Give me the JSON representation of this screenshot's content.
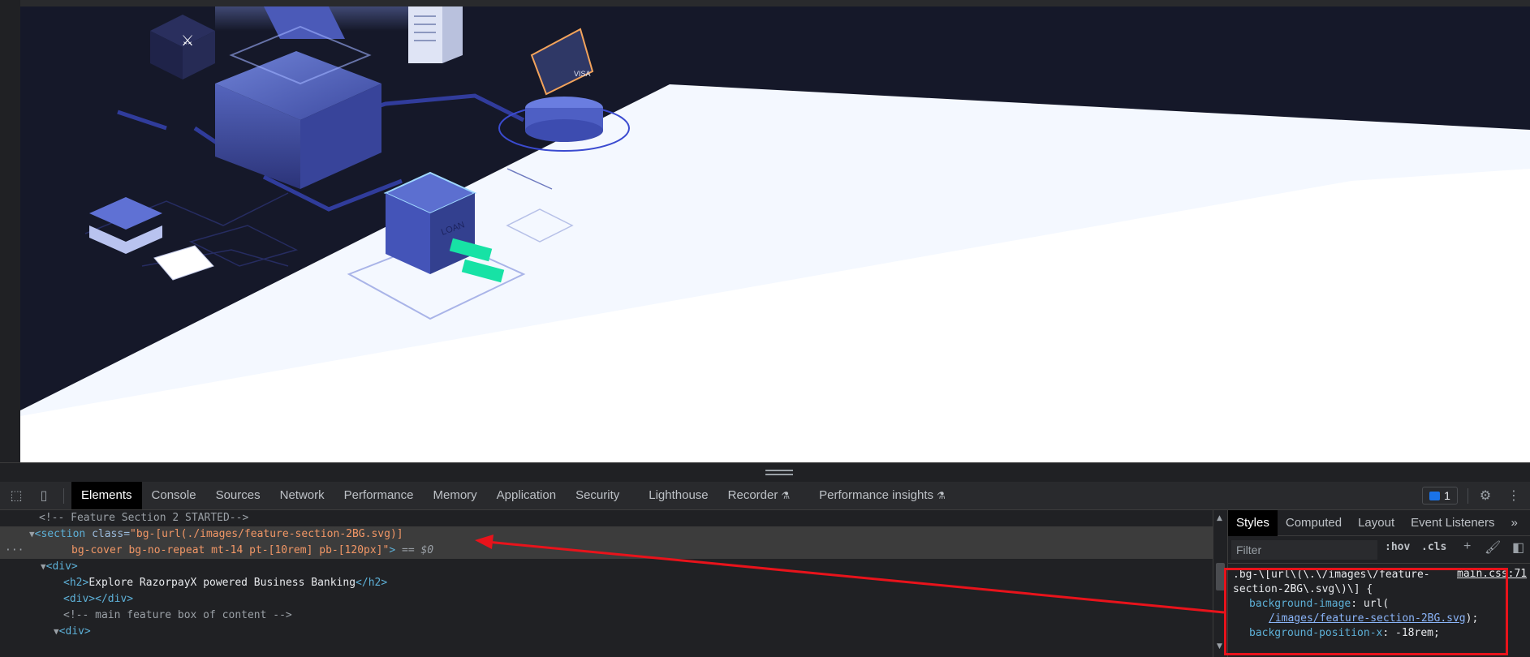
{
  "devtools": {
    "tabs": [
      {
        "label": "Elements",
        "active": true,
        "experimental": false
      },
      {
        "label": "Console",
        "active": false,
        "experimental": false
      },
      {
        "label": "Sources",
        "active": false,
        "experimental": false
      },
      {
        "label": "Network",
        "active": false,
        "experimental": false
      },
      {
        "label": "Performance",
        "active": false,
        "experimental": false
      },
      {
        "label": "Memory",
        "active": false,
        "experimental": false
      },
      {
        "label": "Application",
        "active": false,
        "experimental": false
      },
      {
        "label": "Security",
        "active": false,
        "experimental": false
      },
      {
        "label": "Lighthouse",
        "active": false,
        "experimental": false
      },
      {
        "label": "Recorder",
        "active": false,
        "experimental": true
      },
      {
        "label": "Performance insights",
        "active": false,
        "experimental": true
      }
    ],
    "issues_count": "1",
    "toolbar_icons": [
      "inspect-element-icon",
      "device-toolbar-icon",
      "settings-gear-icon",
      "more-options-icon"
    ]
  },
  "elements_panel": {
    "comment1": "<!-- Feature Section 2 STARTED-->",
    "section_tag": "section",
    "section_class_attr": "class",
    "section_class_line1": "\"bg-[url(./images/feature-section-2BG.svg)]",
    "section_class_line2": "bg-cover bg-no-repeat mt-14 pt-[10rem] pb-[120px]\"",
    "section_eq": " == ",
    "section_ref": "$0",
    "div_open": "<div>",
    "h2_open": "<h2>",
    "h2_text": "Explore RazorpayX powered Business Banking",
    "h2_close": "</h2>",
    "empty_div": "<div></div>",
    "comment2": "<!-- main feature box of content -->",
    "div_open2": "<div>"
  },
  "styles_panel": {
    "tabs": [
      "Styles",
      "Computed",
      "Layout",
      "Event Listeners"
    ],
    "active_tab": "Styles",
    "more": "»",
    "filter_placeholder": "Filter",
    "hov": ":hov",
    "cls": ".cls",
    "rule": {
      "selector_line1": ".bg-\\[url\\(\\.\\/images\\/feature-",
      "selector_line2": "section-2BG\\.svg\\)\\] {",
      "source": "main.css:71",
      "prop1": "background-image",
      "prop1_val_prefix": ": url(",
      "prop1_link": "/images/feature-section-2BG.svg",
      "prop1_val_suffix": ");",
      "prop2": "background-position-x",
      "prop2_val": ": -18rem;"
    }
  },
  "annotation": {
    "box_color": "#e8131b",
    "arrow_color": "#e8131b"
  }
}
